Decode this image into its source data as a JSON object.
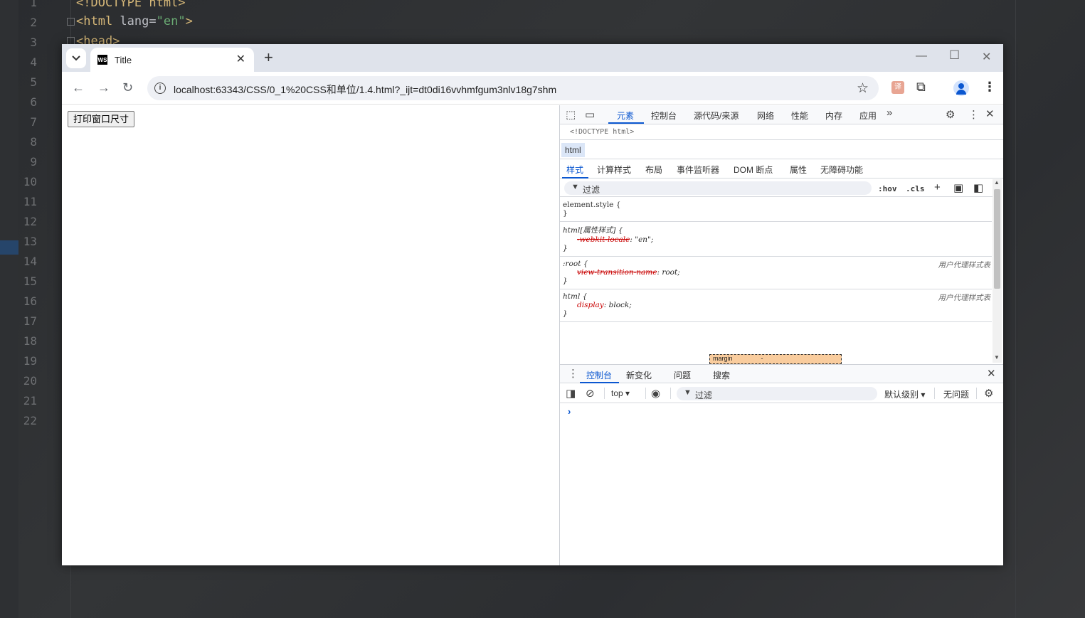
{
  "ide": {
    "line_numbers": [
      "1",
      "2",
      "3",
      "4",
      "5",
      "6",
      "7",
      "8",
      "9",
      "10",
      "11",
      "12",
      "13",
      "14",
      "15",
      "16",
      "17",
      "18",
      "19",
      "20",
      "21",
      "22"
    ],
    "code_line1": "<!DOCTYPE html>",
    "code_line2_tag_open": "<html ",
    "code_line2_attr": "lang=",
    "code_line2_value": "\"en\"",
    "code_line2_close": ">",
    "code_line3": "<head>"
  },
  "browser": {
    "tab_title": "Title",
    "favicon_text": "WS",
    "url": "localhost:63343/CSS/0_1%20CSS和单位/1.4.html?_ijt=dt0di16vvhmfgum3nlv18g7shm"
  },
  "page": {
    "button_label": "打印窗口尺寸"
  },
  "devtools": {
    "tabs": [
      "元素",
      "控制台",
      "源代码/来源",
      "网络",
      "性能",
      "内存",
      "应用"
    ],
    "dom_line": "<!DOCTYPE html>",
    "breadcrumb": "html",
    "sub_tabs": [
      "样式",
      "计算样式",
      "布局",
      "事件监听器",
      "DOM 断点",
      "属性",
      "无障碍功能"
    ],
    "filter_placeholder": "过滤",
    "hov": ":hov",
    "cls": ".cls",
    "rules": [
      {
        "selector": "element.style {",
        "close": "}"
      },
      {
        "selector": "html[属性样式] {",
        "prop": "-webkit-locale",
        "value": "\"en\";",
        "close": "}"
      },
      {
        "selector": ":root {",
        "origin": "用户代理样式表",
        "prop": "view-transition-name",
        "value": "root;",
        "close": "}"
      },
      {
        "selector": "html {",
        "origin": "用户代理样式表",
        "prop": "display",
        "value": "block;",
        "close": "}"
      }
    ],
    "box_model_label": "margin",
    "box_model_value": "-",
    "drawer_tabs": [
      "控制台",
      "新变化",
      "问题",
      "搜索"
    ],
    "console_context": "top",
    "console_filter": "过滤",
    "console_level": "默认级别",
    "console_issues": "无问题",
    "prompt": "›"
  }
}
